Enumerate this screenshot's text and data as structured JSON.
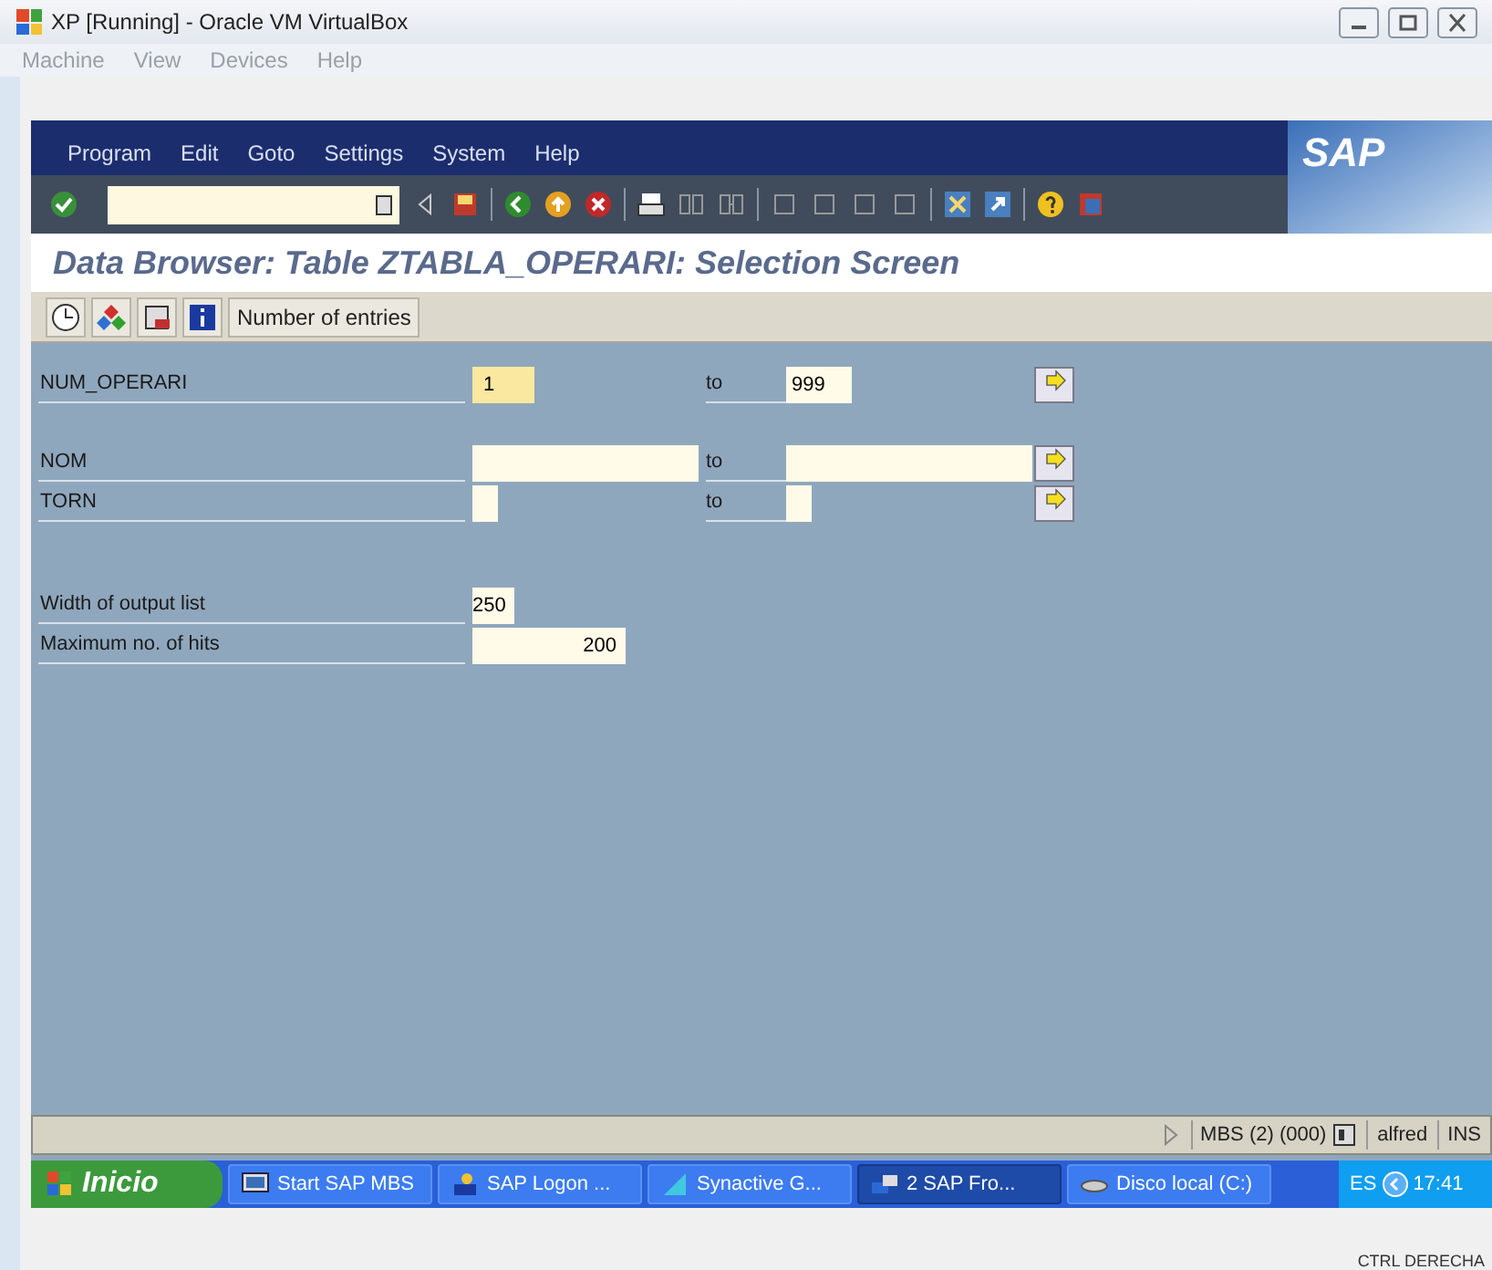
{
  "host_window": {
    "title": "XP [Running] - Oracle VM VirtualBox",
    "menu": [
      "Machine",
      "View",
      "Devices",
      "Help"
    ]
  },
  "sap_menu": [
    "Program",
    "Edit",
    "Goto",
    "Settings",
    "System",
    "Help"
  ],
  "screen_title": "Data Browser: Table ZTABLA_OPERARI: Selection Screen",
  "app_toolbar": {
    "button": "Number of entries"
  },
  "selections": [
    {
      "label": "NUM_OPERARI",
      "low": "1",
      "high": "999",
      "to": "to",
      "focused": true
    },
    {
      "label": "NOM",
      "to": "to",
      "focused": false
    },
    {
      "label": "TORN",
      "to": "to",
      "focused": false
    }
  ],
  "parameters": [
    {
      "label": "Width of output list",
      "value": "250"
    },
    {
      "label": "Maximum no. of hits",
      "value": "200"
    }
  ],
  "logo": "SAP",
  "status_bar": {
    "system": "MBS (2) (000)",
    "user": "alfred",
    "mode": "INS"
  },
  "taskbar": {
    "start": "Inicio",
    "items": [
      {
        "label": "Start SAP MBS",
        "selected": false
      },
      {
        "label": "SAP Logon ...",
        "selected": false
      },
      {
        "label": "Synactive G...",
        "selected": false
      },
      {
        "label": "2 SAP Fro...",
        "selected": true
      },
      {
        "label": "Disco local (C:)",
        "selected": false
      }
    ],
    "language": "ES",
    "clock": "17:41"
  },
  "host_status": "CTRL DERECHA"
}
